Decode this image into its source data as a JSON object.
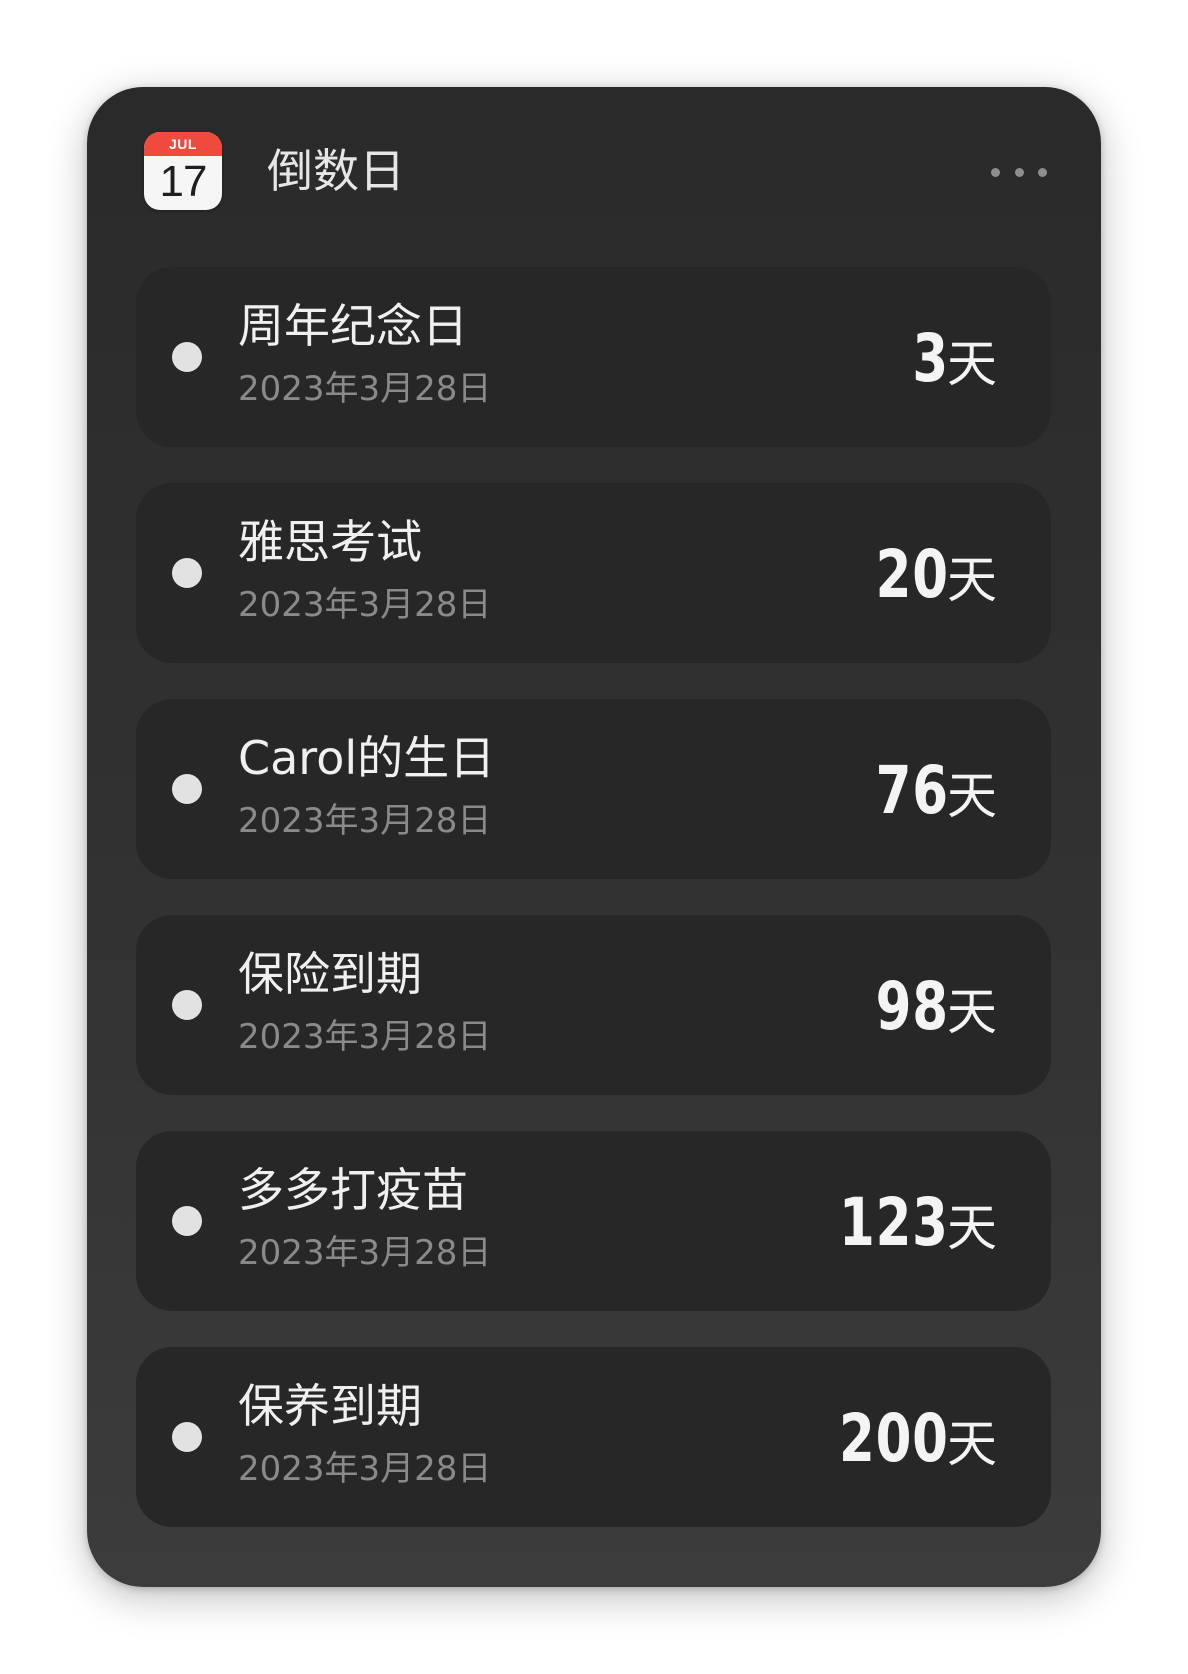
{
  "widget": {
    "title": "倒数日",
    "calendar_icon": {
      "month": "JUL",
      "day": "17",
      "icon": "calendar-icon",
      "accent": "#f04a3e"
    },
    "more_icon": "more-horizontal-icon"
  },
  "events": [
    {
      "name": "周年纪念日",
      "date": "2023年3月28日",
      "count": "3",
      "unit": "天"
    },
    {
      "name": "雅思考试",
      "date": "2023年3月28日",
      "count": "20",
      "unit": "天"
    },
    {
      "name": "Carol的生日",
      "date": "2023年3月28日",
      "count": "76",
      "unit": "天"
    },
    {
      "name": "保险到期",
      "date": "2023年3月28日",
      "count": "98",
      "unit": "天"
    },
    {
      "name": "多多打疫苗",
      "date": "2023年3月28日",
      "count": "123",
      "unit": "天"
    },
    {
      "name": "保养到期",
      "date": "2023年3月28日",
      "count": "200",
      "unit": "天"
    }
  ],
  "colors": {
    "background": "#ffffff",
    "widget": "#2e2e2e",
    "card": "#272727",
    "primary_text": "#f0f0f0",
    "secondary_text": "#8a8a8a",
    "bullet": "#e2e2e2"
  }
}
